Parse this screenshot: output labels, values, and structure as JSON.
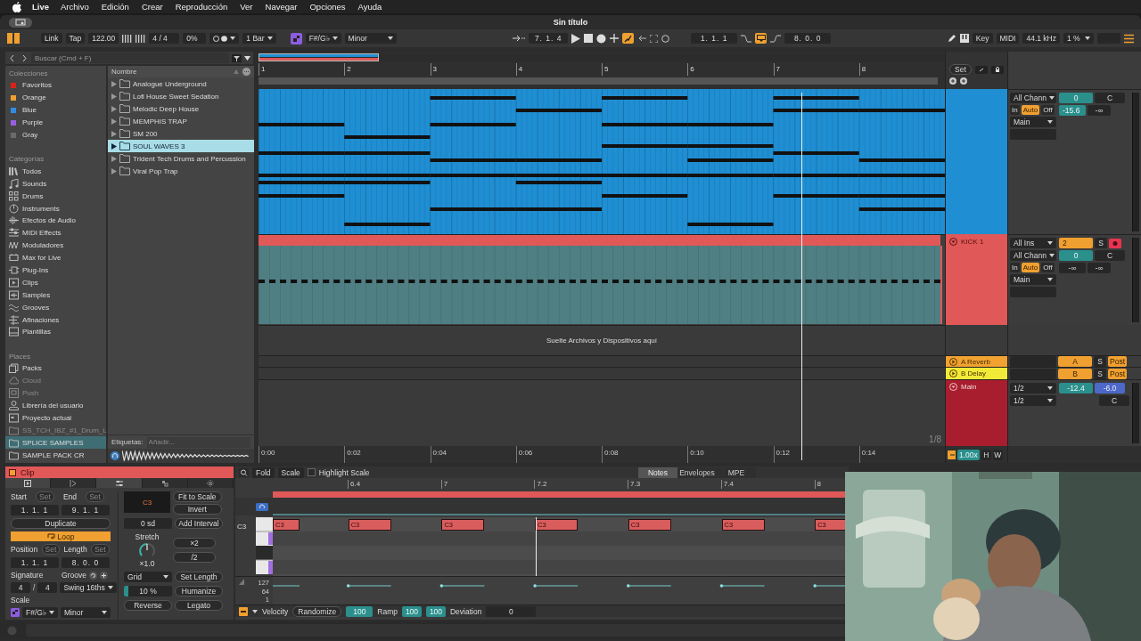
{
  "menu_bar": {
    "app": "Live",
    "items": [
      "Archivo",
      "Edición",
      "Crear",
      "Reproducción",
      "Ver",
      "Navegar",
      "Opciones",
      "Ayuda"
    ]
  },
  "window": {
    "title": "Sin título"
  },
  "transport": {
    "link": "Link",
    "tap": "Tap",
    "tempo": "122.00",
    "signature": "4 / 4",
    "swing": "0%",
    "quantize": "1 Bar",
    "scale_root": "F#/G♭",
    "scale_mode": "Minor",
    "position": "7. 1. 4",
    "automation_arm": true,
    "loop_start": "1. 1. 1",
    "loop": true,
    "loop_length": "8. 0. 0",
    "key": "Key",
    "midi": "MIDI",
    "sample_rate": "44.1 kHz",
    "cpu": "1 %"
  },
  "browser": {
    "search": {
      "placeholder": "Buscar (Cmd + F)"
    },
    "collections_heading": "Colecciones",
    "collections": [
      {
        "label": "Favoritos",
        "color": "#d9221c",
        "selected": false
      },
      {
        "label": "Orange",
        "color": "#f0a030",
        "selected": false
      },
      {
        "label": "Blue",
        "color": "#2f8ee0",
        "selected": false
      },
      {
        "label": "Purple",
        "color": "#9a5fe0",
        "selected": false
      },
      {
        "label": "Gray",
        "color": "#6a6a6a",
        "selected": false
      }
    ],
    "categories_heading": "Categorías",
    "categories": [
      {
        "label": "Todos",
        "selected": false
      },
      {
        "label": "Sounds",
        "selected": false
      },
      {
        "label": "Drums",
        "selected": false
      },
      {
        "label": "Instruments",
        "selected": false
      },
      {
        "label": "Efectos de Audio",
        "selected": false
      },
      {
        "label": "MIDI Effects",
        "selected": false
      },
      {
        "label": "Moduladores",
        "selected": false
      },
      {
        "label": "Max for Live",
        "selected": false
      },
      {
        "label": "Plug-Ins",
        "selected": false
      },
      {
        "label": "Clips",
        "selected": false
      },
      {
        "label": "Samples",
        "selected": false
      },
      {
        "label": "Grooves",
        "selected": false
      },
      {
        "label": "Afinaciones",
        "selected": false
      },
      {
        "label": "Plantillas",
        "selected": false
      }
    ],
    "places_heading": "Places",
    "places": [
      {
        "label": "Packs",
        "selected": false,
        "disabled": false
      },
      {
        "label": "Cloud",
        "selected": false,
        "disabled": true
      },
      {
        "label": "Push",
        "selected": false,
        "disabled": true
      },
      {
        "label": "Librería del usuario",
        "selected": false,
        "disabled": false
      },
      {
        "label": "Proyecto actual",
        "selected": false,
        "disabled": false
      },
      {
        "label": "SS_TCH_IBZ_#1_Drum_L",
        "selected": false,
        "disabled": true
      },
      {
        "label": "SPLICE SAMPLES",
        "selected": true,
        "disabled": false
      },
      {
        "label": "SAMPLE PACK CR",
        "selected": false,
        "disabled": false
      }
    ],
    "column_heading": "Nombre",
    "files": [
      {
        "name": "Analogue Underground",
        "selected": false
      },
      {
        "name": "Lofi House Sweet Sedation",
        "selected": false
      },
      {
        "name": "Melodic Deep House",
        "selected": false
      },
      {
        "name": "MEMPHIS TRAP",
        "selected": false
      },
      {
        "name": "SM 200",
        "selected": false
      },
      {
        "name": "SOUL WAVES 3",
        "selected": true
      },
      {
        "name": "Trident Tech Drums and Percussion",
        "selected": false
      },
      {
        "name": "Viral Pop Trap",
        "selected": false
      }
    ],
    "tags": {
      "label": "Etiquetas:",
      "placeholder": "Añadir..."
    }
  },
  "arrangement": {
    "bars": [
      "1",
      "2",
      "3",
      "4",
      "5",
      "6",
      "7",
      "8"
    ],
    "set": "Set",
    "tracks": [
      {
        "color": "#1f8ed2",
        "input_channel": "All Chann",
        "monitor": [
          {
            "label": "In",
            "selected": false
          },
          {
            "label": "Auto",
            "selected": true
          },
          {
            "label": "Off",
            "selected": false
          }
        ],
        "output": "Main",
        "volume": "0",
        "pan": "C",
        "peak": "-15.6",
        "peak_2": "-∞"
      },
      {
        "name": "KICK 1",
        "color": "#e05858",
        "input_type": "All Ins",
        "input_channel": "All Chann",
        "monitor": [
          {
            "label": "In",
            "selected": false
          },
          {
            "label": "Auto",
            "selected": true
          },
          {
            "label": "Off",
            "selected": false
          }
        ],
        "output": "Main",
        "number": "2",
        "solo": "S",
        "arm": true,
        "volume": "0",
        "pan": "C",
        "peak": "-∞",
        "peak_2": "-∞"
      }
    ],
    "drop_zone": "Suelte Archivos y Dispositivos aquí",
    "returns": [
      {
        "name": "A Reverb",
        "color": "#f2a230",
        "letter": "A",
        "solo": "S",
        "send_mode": "Post"
      },
      {
        "name": "B Delay",
        "color": "#f2ea38",
        "letter": "B",
        "solo": "S",
        "send_mode": "Post"
      }
    ],
    "main": {
      "name": "Main",
      "color": "#a81e2e",
      "cue_out": "1/2",
      "main_out": "1/2",
      "volume": "-12.4",
      "cue_volume": "-6.0",
      "pan": "C",
      "grid": "1/8"
    },
    "time_ruler": [
      "0:00",
      "0:02",
      "0:04",
      "0:06",
      "0:08",
      "0:10",
      "0:12",
      "0:14"
    ],
    "zoom": "1.00x",
    "h": "H",
    "w": "W"
  },
  "clip_panel": {
    "title": "Clip",
    "start": {
      "label": "Start",
      "set": "Set",
      "value": "1. 1. 1"
    },
    "end": {
      "label": "End",
      "set": "Set",
      "value": "9. 1. 1"
    },
    "duplicate": "Duplicate",
    "loop": {
      "label": "Loop",
      "on": true
    },
    "position": {
      "label": "Position",
      "set": "Set",
      "value": "1. 1. 1"
    },
    "length": {
      "label": "Length",
      "set": "Set",
      "value": "8. 0. 0"
    },
    "signature": {
      "label": "Signature",
      "numerator": "4",
      "separator": "/",
      "denominator": "4"
    },
    "groove": {
      "label": "Groove",
      "value": "Swing 16ths"
    },
    "scale": {
      "label": "Scale",
      "root": "F#/G♭",
      "mode": "Minor"
    },
    "note": "C3",
    "fit_to_scale": "Fit to Scale",
    "invert": "Invert",
    "interval": "0 sd",
    "add_interval": "Add Interval",
    "stretch": {
      "label": "Stretch",
      "value": "×1.0"
    },
    "double": "×2",
    "half": "/2",
    "grid": "Grid",
    "set_length": "Set Length",
    "humanize_amount": {
      "value": "10 %",
      "level": 0.1
    },
    "humanize": "Humanize",
    "reverse": "Reverse",
    "legato": "Legato"
  },
  "editor": {
    "fold": "Fold",
    "scale": "Scale",
    "highlight_scale": {
      "label": "Highlight Scale",
      "checked": false
    },
    "tabs": [
      {
        "label": "Notes",
        "selected": true
      },
      {
        "label": "Envelopes",
        "selected": false
      },
      {
        "label": "MPE",
        "selected": false
      }
    ],
    "ruler": [
      "6.4",
      "7",
      "7.2",
      "7.3",
      "7.4",
      "8"
    ],
    "key_label": "C3",
    "notes": [
      "C3",
      "C3",
      "C3",
      "C3",
      "C3",
      "C3",
      "C3"
    ],
    "velocity_scale": [
      "127",
      "64",
      "1"
    ],
    "velocity": {
      "label": "Velocity",
      "randomize": "Randomize",
      "randomize_value": "100",
      "ramp": "Ramp",
      "ramp_start": "100",
      "ramp_end": "100",
      "deviation": "Deviation",
      "deviation_value": "0"
    }
  }
}
